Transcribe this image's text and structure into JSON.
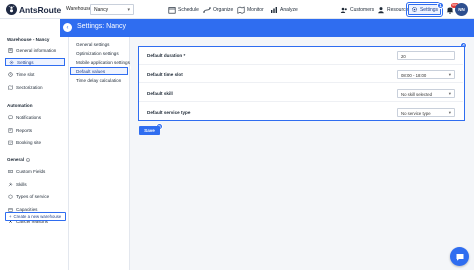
{
  "app": {
    "name": "AntsRoute"
  },
  "topbar": {
    "warehouse_label": "Warehouse:",
    "warehouse_value": "Nancy",
    "nav": [
      {
        "label": "Schedule",
        "icon": "calendar-icon"
      },
      {
        "label": "Organize",
        "icon": "route-icon"
      },
      {
        "label": "Monitor",
        "icon": "map-icon"
      },
      {
        "label": "Analyze",
        "icon": "chart-icon"
      }
    ],
    "customers": "Customers",
    "resources": "Resources",
    "settings": "Settings",
    "notif_count": "99+",
    "avatar_initials": "NN"
  },
  "badges": [
    "1",
    "2",
    "3",
    "4",
    "5"
  ],
  "sidebar": {
    "warehouse_section": "Warehouse - Nancy",
    "warehouse_items": [
      "General information",
      "Settings",
      "Time slot",
      "Sectorization"
    ],
    "automation_section": "Automation",
    "automation_items": [
      "Notifications",
      "Reports",
      "Booking site"
    ],
    "general_section": "General",
    "general_items": [
      "Custom Fields",
      "Skills",
      "Types of service",
      "Capacities",
      "Cancel reasons"
    ],
    "create_button": "Create a new warehouse"
  },
  "header": {
    "back_icon": "arrow-left-icon",
    "title": "Settings: Nancy"
  },
  "submenu": {
    "items": [
      "General settings",
      "Optimization settings",
      "Mobile application settings",
      "Default values",
      "Time delay calculation"
    ],
    "active_index": 3
  },
  "form": {
    "rows": [
      {
        "label": "Default duration *",
        "value": "20",
        "type": "input"
      },
      {
        "label": "Default time slot",
        "value": "08:00 - 18:00",
        "type": "select"
      },
      {
        "label": "Default skill",
        "value": "No skill selected",
        "type": "select"
      },
      {
        "label": "Default service type",
        "value": "No service type",
        "type": "select"
      }
    ],
    "save_label": "Save"
  },
  "colors": {
    "accent": "#2f6df0",
    "brand_dark": "#1f2a44"
  }
}
